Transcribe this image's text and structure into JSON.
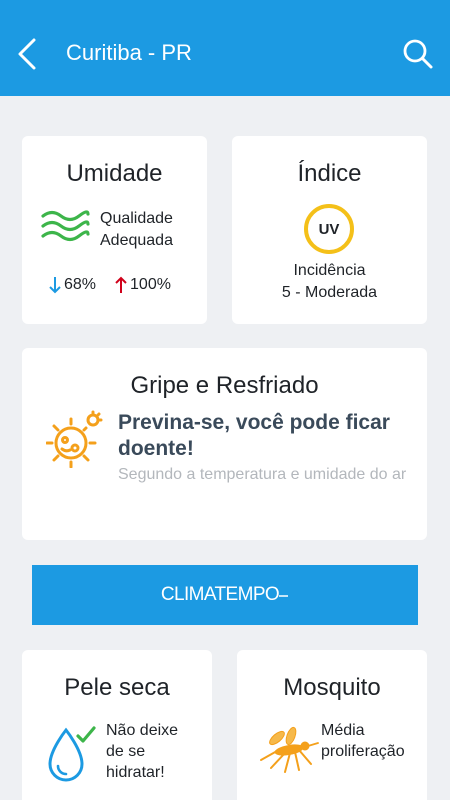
{
  "header": {
    "title": "Curitiba - PR",
    "background": "#1c9ae2",
    "back_icon": "chevron-left-icon",
    "search_icon": "search-icon"
  },
  "umidade": {
    "title": "Umidade",
    "icon": "waves-icon",
    "quality_line1": "Qualidade",
    "quality_line2": "Adequada",
    "min": "68%",
    "max": "100%"
  },
  "indice": {
    "title": "Índice",
    "icon_label": "UV",
    "line1": "Incidência",
    "line2": "5 - Moderada"
  },
  "gripe": {
    "title": "Gripe e Resfriado",
    "icon": "germ-icon",
    "headline": "Previna-se, você pode ficar doente!",
    "subtitle": "Segundo a temperatura e umidade do ar"
  },
  "banner": {
    "logo": "CLIMATEMPO"
  },
  "pele": {
    "title": "Pele seca",
    "icon": "water-drop-icon",
    "line1": "Não deixe",
    "line2": "de se",
    "line3": "hidratar!"
  },
  "mosquito": {
    "title": "Mosquito",
    "icon": "mosquito-icon",
    "line1": "Média",
    "line2": "proliferação"
  },
  "colors": {
    "accent": "#1c9ae2",
    "green": "#3db54a",
    "yellow": "#f4c019",
    "down_arrow": "#1c9ae2",
    "up_arrow": "#d0021b"
  }
}
